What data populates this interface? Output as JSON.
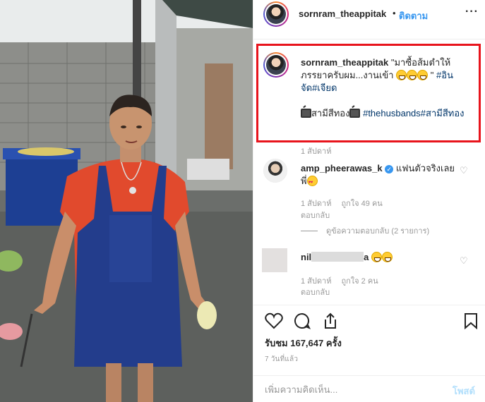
{
  "header": {
    "username": "sornram_theappitak",
    "separator": "•",
    "follow_label": "ติดตาม",
    "more_label": "···"
  },
  "caption": {
    "username": "sornram_theappitak",
    "text_part1": " \"มาซื้อส้มตำให้ภรรยาครับผม...งานเข้า ",
    "text_part2": " \" ",
    "tag1": "#อินจัด",
    "tag2": "#เจียด",
    "line2_text1": "สามีสีทอง",
    "line2_tag1": "#thehusbands",
    "line2_tag2": "#สามีสีทอง",
    "time": "1 สัปดาห์"
  },
  "comments": [
    {
      "username": "amp_pheerawas_k",
      "verified_mark": "✓",
      "text": " แฟนตัวจริงเลยพี่",
      "time": "1 สัปดาห์",
      "likes": "ถูกใจ 49 คน",
      "reply": "ตอบกลับ",
      "view_replies": "ดูข้อความตอบกลับ (2 รายการ)"
    },
    {
      "username_visible": "nil",
      "username_suffix": "a ",
      "time": "1 สัปดาห์",
      "likes": "ถูกใจ 2 คน",
      "reply": "ตอบกลับ"
    }
  ],
  "stats": {
    "views": "รับชม 167,647 ครั้ง",
    "posted_ago": "7 วันที่แล้ว"
  },
  "add_comment": {
    "placeholder": "เพิ่มความคิดเห็น...",
    "post_label": "โพสต์"
  },
  "colors": {
    "highlight_border": "#e8141c",
    "follow_blue": "#3897f0",
    "hashtag": "#003569",
    "post_disabled": "#b2dffc"
  }
}
